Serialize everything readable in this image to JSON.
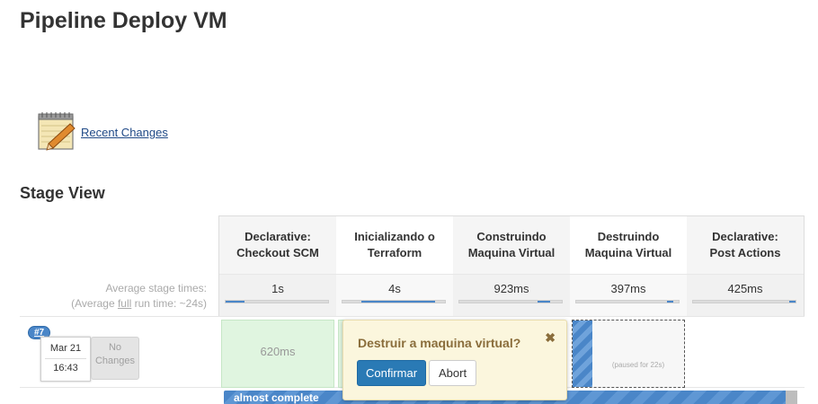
{
  "page": {
    "title": "Pipeline Deploy VM"
  },
  "recent_changes": {
    "label": "Recent Changes",
    "icon": "notepad-icon"
  },
  "stage_view": {
    "title": "Stage View",
    "avg_label": "Average stage times:",
    "avg_full_prefix": "(Average ",
    "avg_full_link": "full",
    "avg_full_suffix": " run time: ~24s)",
    "stages": [
      {
        "name_line1": "Declarative:",
        "name_line2": "Checkout SCM",
        "avg": "1s",
        "bar_start": 0.0,
        "bar_fill": 0.18
      },
      {
        "name_line1": "Inicializando o",
        "name_line2": "Terraform",
        "avg": "4s",
        "bar_start": 0.18,
        "bar_fill": 0.72
      },
      {
        "name_line1": "Construindo",
        "name_line2": "Maquina Virtual",
        "avg": "923ms",
        "bar_start": 0.76,
        "bar_fill": 0.13
      },
      {
        "name_line1": "Destruindo",
        "name_line2": "Maquina Virtual",
        "avg": "397ms",
        "bar_start": 0.89,
        "bar_fill": 0.06
      },
      {
        "name_line1": "Declarative:",
        "name_line2": "Post Actions",
        "avg": "425ms",
        "bar_start": 0.94,
        "bar_fill": 0.06
      }
    ]
  },
  "build": {
    "number": "#7",
    "date": "Mar 21",
    "time": "16:43",
    "changes_line1": "No",
    "changes_line2": "Changes",
    "stage1_time": "620ms",
    "paused_text": "(paused for 22s)",
    "progress_label": "almost complete",
    "progress": 0.98
  },
  "prompt": {
    "question": "Destruir a maquina virtual?",
    "confirm_label": "Confirmar",
    "abort_label": "Abort",
    "close_glyph": "✖"
  },
  "colors": {
    "accent": "#4a86c8",
    "success_bg": "#e0f5e0",
    "prompt_bg": "#fbf6dd",
    "confirm_btn": "#2a7ab5"
  }
}
